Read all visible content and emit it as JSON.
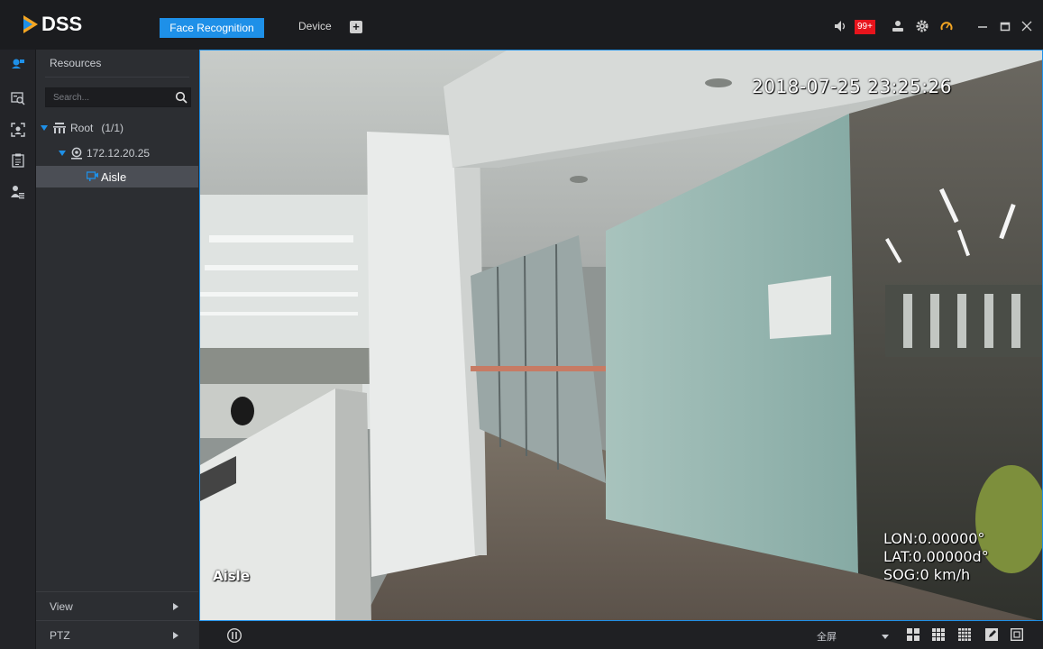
{
  "app": {
    "logo_text": "DSS"
  },
  "tabs": [
    {
      "label": "Face Recognition",
      "active": true
    },
    {
      "label": "Device",
      "active": false
    }
  ],
  "titlebar": {
    "add_tab_glyph": "+",
    "alarm_badge": "99+",
    "icons": [
      "speaker-icon",
      "user-icon",
      "gear-icon",
      "gauge-icon",
      "minimize-icon",
      "maximize-icon",
      "close-icon"
    ]
  },
  "rail": {
    "icons": [
      "face-monitor-icon",
      "face-search-icon",
      "face-capture-icon",
      "report-icon",
      "person-library-icon"
    ]
  },
  "resources": {
    "title": "Resources",
    "search_placeholder": "Search...",
    "tree": [
      {
        "label": "Root",
        "count": "(1/1)",
        "level": 0,
        "icon": "org-icon",
        "expanded": true
      },
      {
        "label": "172.12.20.25",
        "level": 1,
        "icon": "device-icon",
        "expanded": true
      },
      {
        "label": "Aisle",
        "level": 2,
        "icon": "camera-channel-icon",
        "selected": true
      }
    ],
    "footer": [
      {
        "label": "View"
      },
      {
        "label": "PTZ"
      }
    ]
  },
  "video": {
    "timestamp": "2018-07-25 23:25:26",
    "channel_name": "Aisle",
    "lon": "LON:0.00000°",
    "lat": "LAT:0.00000d°",
    "sog": "SOG:0 km/h"
  },
  "bottombar": {
    "scale_value": "全屏",
    "layout_icons": [
      "layout-4-icon",
      "layout-9-icon",
      "layout-16-icon",
      "edit-layout-icon",
      "fullscreen-icon"
    ]
  },
  "colors": {
    "accent": "#1e90e8",
    "badge": "#e7141c",
    "gauge": "#f5a623"
  }
}
